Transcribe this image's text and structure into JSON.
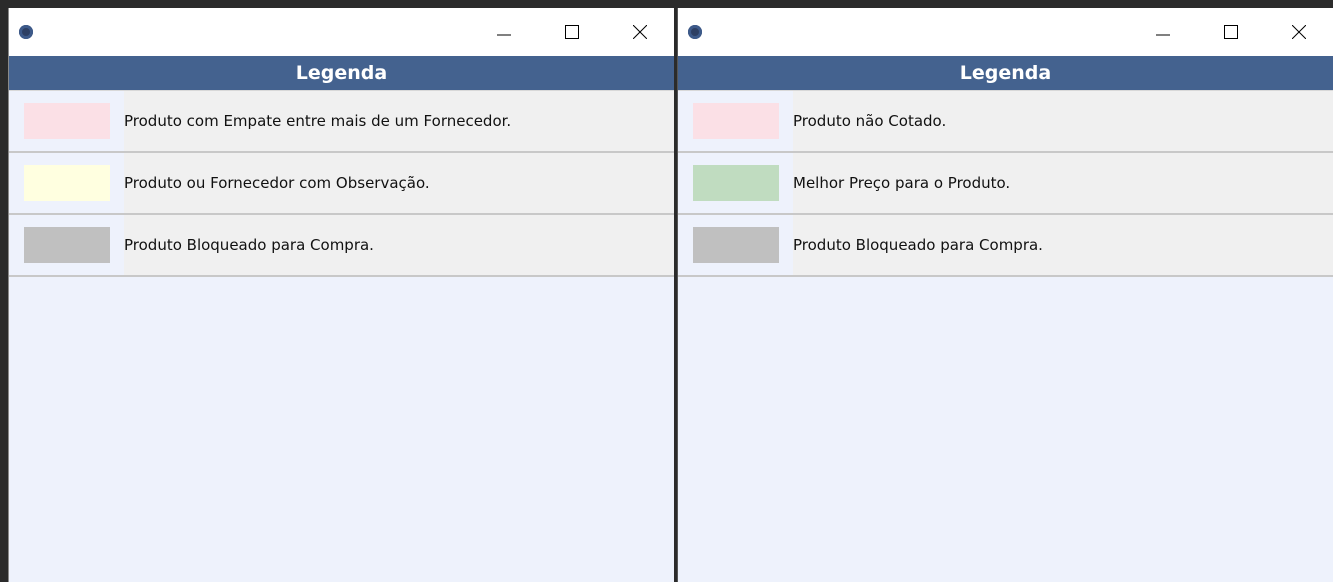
{
  "windows": [
    {
      "header": "Legenda",
      "items": [
        {
          "label": "Produto com Empate entre mais de um Fornecedor.",
          "color": "#fbe0e6"
        },
        {
          "label": "Produto ou Fornecedor com Observação.",
          "color": "#ffffe0"
        },
        {
          "label": "Produto Bloqueado para Compra.",
          "color": "#c0c0c0"
        }
      ]
    },
    {
      "header": "Legenda",
      "items": [
        {
          "label": "Produto não Cotado.",
          "color": "#fbe0e6"
        },
        {
          "label": "Melhor Preço para o Produto.",
          "color": "#c0dcc0"
        },
        {
          "label": "Produto Bloqueado para Compra.",
          "color": "#c0c0c0"
        }
      ]
    }
  ]
}
